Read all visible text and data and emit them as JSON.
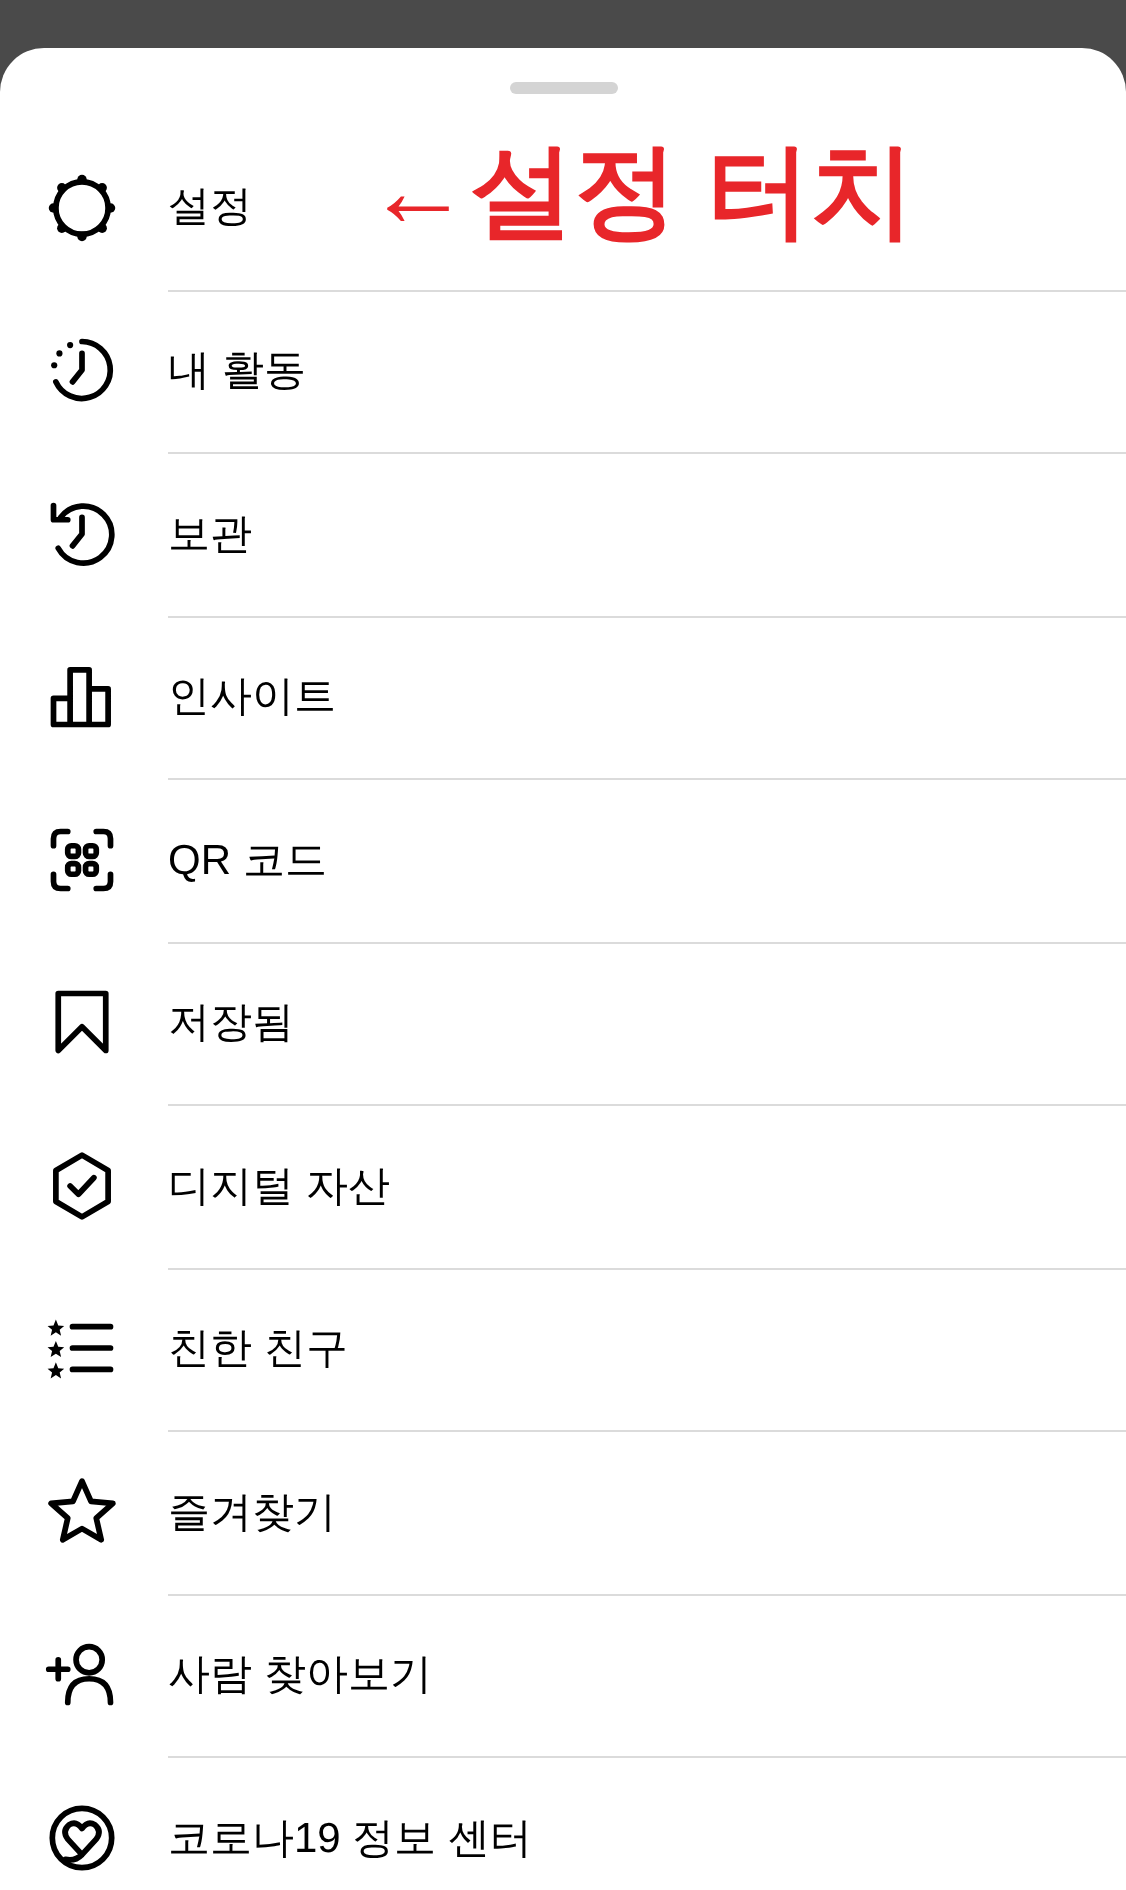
{
  "menu": {
    "items": [
      {
        "label": "설정"
      },
      {
        "label": "내 활동"
      },
      {
        "label": "보관"
      },
      {
        "label": "인사이트"
      },
      {
        "label": "QR 코드"
      },
      {
        "label": "저장됨"
      },
      {
        "label": "디지털 자산"
      },
      {
        "label": "친한 친구"
      },
      {
        "label": "즐겨찾기"
      },
      {
        "label": "사람 찾아보기"
      },
      {
        "label": "코로나19 정보 센터"
      }
    ]
  },
  "annotation": {
    "text": "←설정 터치"
  }
}
